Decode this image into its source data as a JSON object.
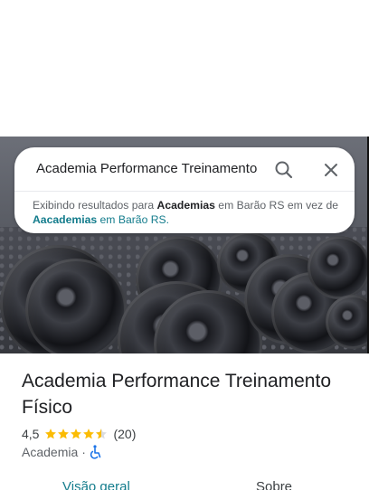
{
  "search": {
    "query": "Academia Performance Treinamento",
    "notice_prefix": "Exibindo resultados para ",
    "notice_term": "Academias",
    "notice_mid": " em Barão RS em vez de ",
    "notice_alt_term": "Aacademias",
    "notice_alt_suffix": " em Barão RS."
  },
  "place": {
    "title": "Academia Performance Treinamento Físico",
    "rating": "4,5",
    "rating_value": 4.5,
    "reviews": "(20)",
    "category": "Academia",
    "separator": "·"
  },
  "tabs": [
    {
      "label": "Visão geral",
      "active": true
    },
    {
      "label": "Sobre",
      "active": false
    }
  ],
  "colors": {
    "accent": "#137c8c",
    "star": "#fbbc04",
    "accessibility": "#1a73e8"
  },
  "icons": {
    "search": "search-icon",
    "close": "close-icon",
    "accessibility": "wheelchair-icon",
    "star": "star-icon"
  }
}
